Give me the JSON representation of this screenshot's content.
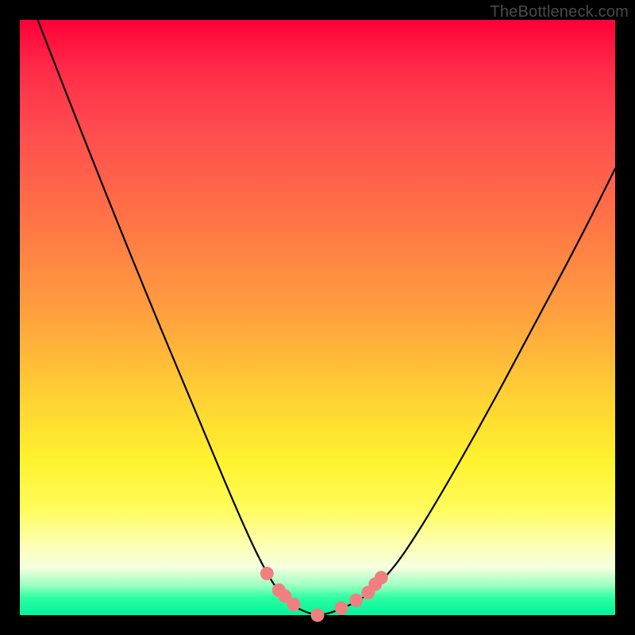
{
  "attribution": "TheBottleneck.com",
  "colors": {
    "frame": "#000000",
    "curve": "#000000",
    "marker": "#f08080",
    "gradient_top": "#ff0038",
    "gradient_bottom": "#00f49a"
  },
  "chart_data": {
    "type": "line",
    "title": "",
    "xlabel": "",
    "ylabel": "",
    "xlim": [
      0,
      100
    ],
    "ylim": [
      0,
      100
    ],
    "x": [
      3,
      10,
      20,
      30,
      38,
      42,
      45,
      48,
      50,
      52,
      55,
      58,
      62,
      65,
      70,
      78,
      86,
      94,
      100
    ],
    "values": [
      100,
      82,
      57,
      33,
      14,
      6,
      2,
      0.5,
      0,
      0.3,
      1.5,
      3,
      7,
      11,
      19,
      33,
      48,
      63,
      75
    ],
    "annotations": {
      "note": "V-shaped bottleneck curve; markers cluster around the trough where mismatch is lowest (green band).",
      "marker_points_x": [
        41.5,
        43.5,
        44.5,
        46.0,
        50.0,
        54.0,
        56.5,
        58.5,
        59.7,
        60.7
      ],
      "marker_points_y": [
        7.0,
        4.2,
        3.2,
        1.8,
        0.0,
        1.2,
        2.5,
        3.8,
        5.2,
        6.3
      ]
    }
  }
}
